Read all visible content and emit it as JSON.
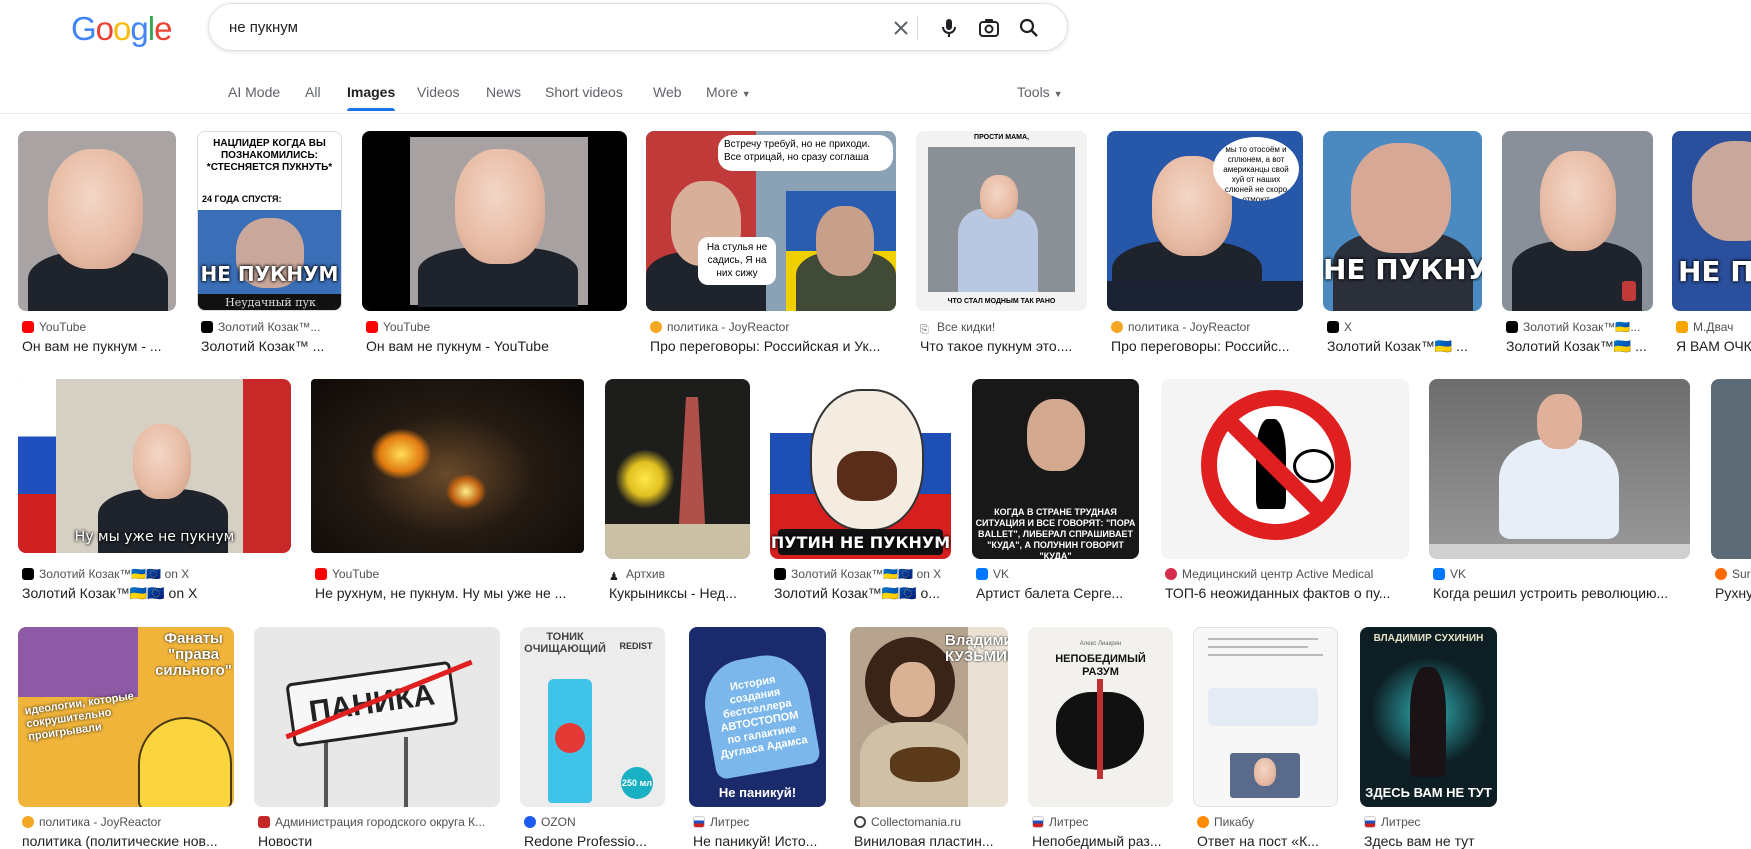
{
  "header": {
    "logo": "Google",
    "query": "не пукнум"
  },
  "tabs": [
    "AI Mode",
    "All",
    "Images",
    "Videos",
    "News",
    "Short videos",
    "Web",
    "More"
  ],
  "active_tab": "Images",
  "tools_label": "Tools",
  "colors": {
    "accent": "#1a73e8",
    "youtube": "#ff0000",
    "x": "#000000"
  },
  "results": [
    {
      "source": "YouTube",
      "title": "Он вам не пукнум - ...",
      "icon": "youtube-icon"
    },
    {
      "source": "Золотий Козак™...",
      "title": "Золотий Козак™ ...",
      "icon": "x-icon",
      "caption_top": "НАЦЛИДЕР КОГДА ВЫ ПОЗНАКОМИЛИСЬ: *СТЕСНЯЕТСЯ ПУКНУТЬ*",
      "caption_mid": "24 ГОДА СПУСТЯ:",
      "caption": "НЕ ПУКНУМ",
      "caption_bottom": "Неудачный пук"
    },
    {
      "source": "YouTube",
      "title": "Он вам не пукнум - YouTube",
      "icon": "youtube-icon"
    },
    {
      "source": "политика - JoyReactor",
      "title": "Про переговоры: Российская и Ук...",
      "icon": "joyreactor-icon",
      "bubble1": "Встречу требуй, но не приходи. Все отрицай, но сразу соглаша",
      "bubble2": "На стулья не садись, Я на них сижу"
    },
    {
      "source": "Все кидки!",
      "title": "Что такое пукнум это....",
      "icon": "link-icon",
      "caption_top": "ПРОСТИ МАМА,",
      "caption_bottom": "ЧТО СТАЛ МОДНЫМ ТАК РАНО"
    },
    {
      "source": "политика - JoyReactor",
      "title": "Про переговоры: Российс...",
      "icon": "joyreactor-icon",
      "bubble1": "мы то отосоём и сплюнем, а вот американцы свой хуй от наших слюней не скоро отмоют"
    },
    {
      "source": "X",
      "title": "Золотий Козак™🇺🇦 ...",
      "icon": "x-icon",
      "caption": "НЕ ПУКНУМ"
    },
    {
      "source": "Золотий Козак™🇺🇦...",
      "title": "Золотий Козак™🇺🇦 ...",
      "icon": "x-icon"
    },
    {
      "source": "М.Двач",
      "title": "Я ВАМ ОЧК",
      "icon": "dvach-icon",
      "caption": "НЕ П"
    },
    {
      "source": "Золотий Козак™🇺🇦🇪🇺 on X",
      "title": "Золотий Козак™🇺🇦🇪🇺 on X",
      "icon": "x-icon",
      "caption": "Ну мы уже не пукнум"
    },
    {
      "source": "YouTube",
      "title": "Не рухнум, не пукнум. Ну мы уже не ...",
      "icon": "youtube-icon"
    },
    {
      "source": "Артхив",
      "title": "Кукрыниксы - Нед...",
      "icon": "arthive-icon"
    },
    {
      "source": "Золотий Козак™🇺🇦🇪🇺 on X",
      "title": "Золотий Козак™🇺🇦🇪🇺 o...",
      "icon": "x-icon",
      "caption": "ПУТИН НЕ ПУКНУМ"
    },
    {
      "source": "VK",
      "title": "Артист балета Серге...",
      "icon": "vk-icon",
      "caption": "КОГДА В СТРАНЕ ТРУДНАЯ СИТУАЦИЯ И ВСЕ ГОВОРЯТ: \"ПОРА BALLET\", ЛИБЕРАЛ СПРАШИВАЕТ \"КУДА\", А ПОЛУНИН ГОВОРИТ \"КУДА\""
    },
    {
      "source": "Медицинский центр Active Medical",
      "title": "ТОП-6 неожиданных фактов о пу...",
      "icon": "medical-icon"
    },
    {
      "source": "VK",
      "title": "Когда решил устроить революцию...",
      "icon": "vk-icon"
    },
    {
      "source": "Sur",
      "title": "Рухну",
      "icon": "orange-icon"
    },
    {
      "source": "политика - JoyReactor",
      "title": "политика (политические нов...",
      "icon": "joyreactor-icon",
      "caption_top": "Фанаты \"права сильного\"",
      "caption": "идеологии, которые сокрушительно проигрывали"
    },
    {
      "source": "Администрация городского округа К...",
      "title": "Новости",
      "icon": "admin-icon",
      "caption": "ПАНИКА"
    },
    {
      "source": "OZON",
      "title": "Redone Professio...",
      "icon": "ozon-icon",
      "caption_top": "ТОНИК ОЧИЩАЮЩИЙ",
      "caption_mid": "REDIST",
      "caption": "250 мл"
    },
    {
      "source": "Литрес",
      "title": "Не паникуй! Исто...",
      "icon": "litres-icon",
      "caption_top": "История создания бестселлера АВТОСТОПОМ по галактике Дугласа Адамса",
      "caption": "Не паникуй!"
    },
    {
      "source": "Collectomania.ru",
      "title": "Виниловая пластин...",
      "icon": "collectomania-icon",
      "caption": "Владимир КУЗЬМИН"
    },
    {
      "source": "Литрес",
      "title": "Непобедимый раз...",
      "icon": "litres-icon",
      "caption_top": "Алекс Лиакрин",
      "caption": "НЕПОБЕДИМЫЙ РАЗУМ"
    },
    {
      "source": "Пикабу",
      "title": "Ответ на пост «К...",
      "icon": "pikabu-icon"
    },
    {
      "source": "Литрес",
      "title": "Здесь вам не тут",
      "icon": "litres-icon",
      "caption_top": "ВЛАДИМИР СУХИНИН",
      "caption": "ЗДЕСЬ ВАМ НЕ ТУТ"
    }
  ]
}
